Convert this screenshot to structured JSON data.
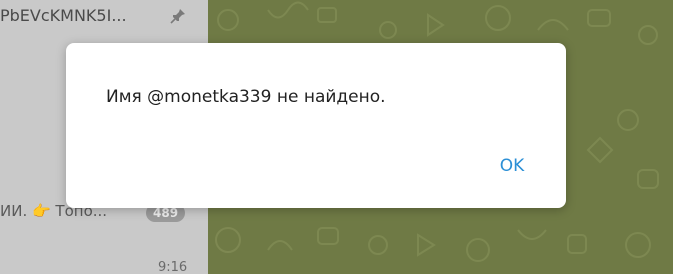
{
  "chat_list": {
    "title": "PbEVcKMNK5I...",
    "snippet": "ИИ. 👉 Топо...",
    "unread_count": "489",
    "time": "9:16"
  },
  "dialog": {
    "message": "Имя @monetka339 не найдено.",
    "ok_label": "OK"
  },
  "colors": {
    "accent": "#2b8fd6",
    "chat_background": "#6f7a45",
    "chat_list_dimmed": "#c9c9c9"
  }
}
